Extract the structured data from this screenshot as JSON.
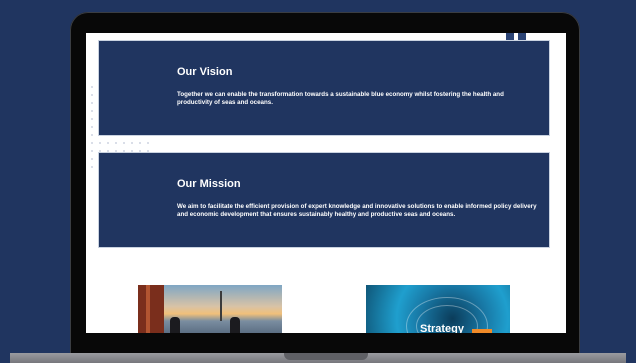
{
  "vision": {
    "title": "Our Vision",
    "text": "Together we can enable the transformation towards a sustainable blue economy whilst fostering the health and productivity of seas and oceans."
  },
  "mission": {
    "title": "Our Mission",
    "text": "We aim to facilitate the efficient provision of expert knowledge and innovative solutions to enable informed policy delivery and economic development that ensures sustainably healthy and productive seas and oceans."
  },
  "cards": {
    "strategy_caption": "Strategy"
  },
  "colors": {
    "page_bg": "#203560",
    "card_bg": "#203560",
    "accent": "#f08a28"
  }
}
